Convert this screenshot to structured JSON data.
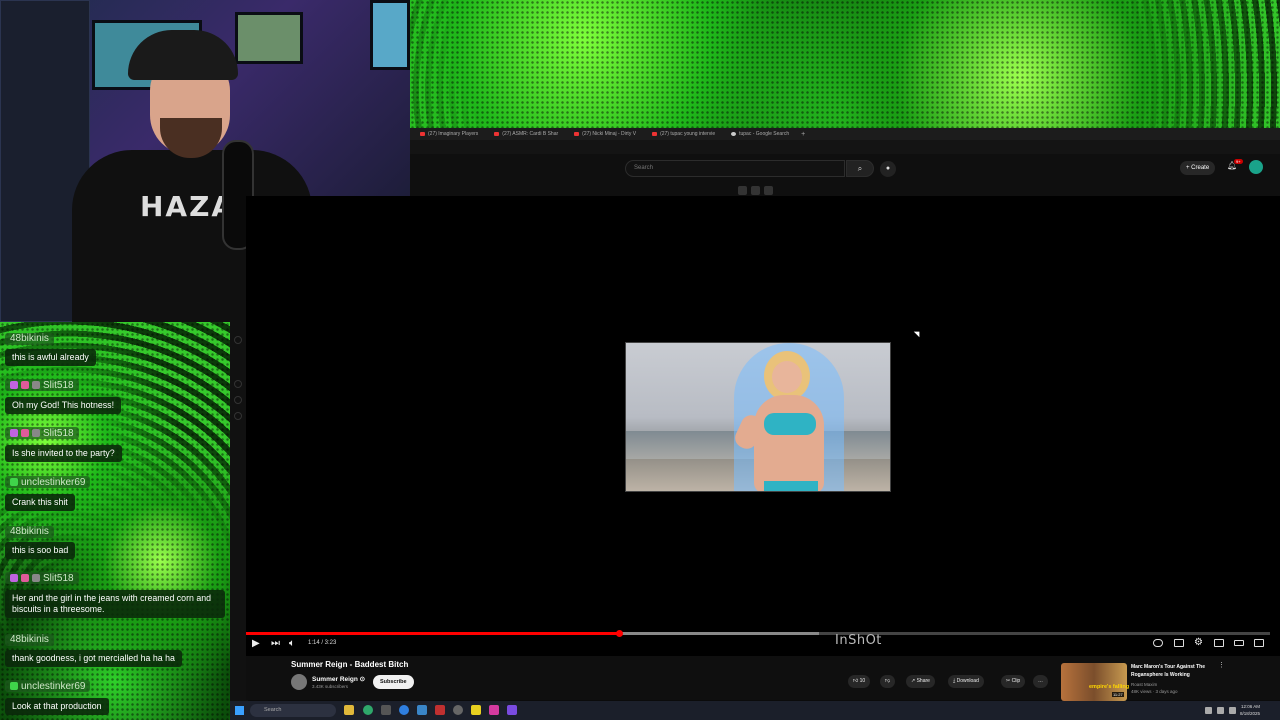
{
  "browser": {
    "tabs": [
      {
        "label": "(27) Imaginary Players"
      },
      {
        "label": "(27) ASMR: Cardi B Shar"
      },
      {
        "label": "(27) Nicki Minaj - Dirty V"
      },
      {
        "label": "(27) tupac young intervie"
      },
      {
        "label": "tupac - Google Search"
      }
    ],
    "new_tab_label": "+"
  },
  "youtube": {
    "search_placeholder": "Search",
    "create_label": "+ Create",
    "notification_count": "9+",
    "video": {
      "title": "Summer Reign - Baddest Bitch",
      "channel": "Summer Reign ⊙",
      "subscribers": "3.43K subscribers",
      "subscribe_label": "Subscribe",
      "time": "1:14 / 3:23",
      "progress_fraction": 0.364,
      "buffer_fraction": 0.56,
      "watermark": "InShOt",
      "likes": "10",
      "share_label": "Share",
      "download_label": "Download",
      "clip_label": "Clip",
      "more_label": "…"
    },
    "recommendation": {
      "title": "Marc Maron's Tour Against The Rogansphere Is Working",
      "channel": "Roast Maxim",
      "meta": "48K views · 3 days ago",
      "duration": "11:27",
      "thumb_caption": "empire's falling"
    }
  },
  "chat": {
    "messages": [
      {
        "user": "48bikinis",
        "text": "this is awful already",
        "badges": 0
      },
      {
        "user": "Slit518",
        "text": "Oh my God! This hotness!",
        "badges": 3
      },
      {
        "user": "Slit518",
        "text": "Is she invited to the party?",
        "badges": 3
      },
      {
        "user": "unclestinker69",
        "text": "Crank this shit",
        "badges": 1
      },
      {
        "user": "48bikinis",
        "text": "this is soo bad",
        "badges": 0
      },
      {
        "user": "Slit518",
        "text": "Her and the girl in the jeans with creamed corn and biscuits in a threesome.",
        "badges": 3
      },
      {
        "user": "48bikinis",
        "text": "thank goodness, i got mercialled ha ha ha",
        "badges": 0
      },
      {
        "user": "unclestinker69",
        "text": "Look at that production",
        "badges": 1
      }
    ]
  },
  "webcam": {
    "shirt_text": "HAZAR"
  },
  "taskbar": {
    "search_placeholder": "Search",
    "time": "12:06 AM",
    "date": "8/18/2025"
  },
  "colors": {
    "youtube_red": "#ff0000",
    "chat_green": "#1fb81a",
    "badge_pink": "#c064e0"
  }
}
